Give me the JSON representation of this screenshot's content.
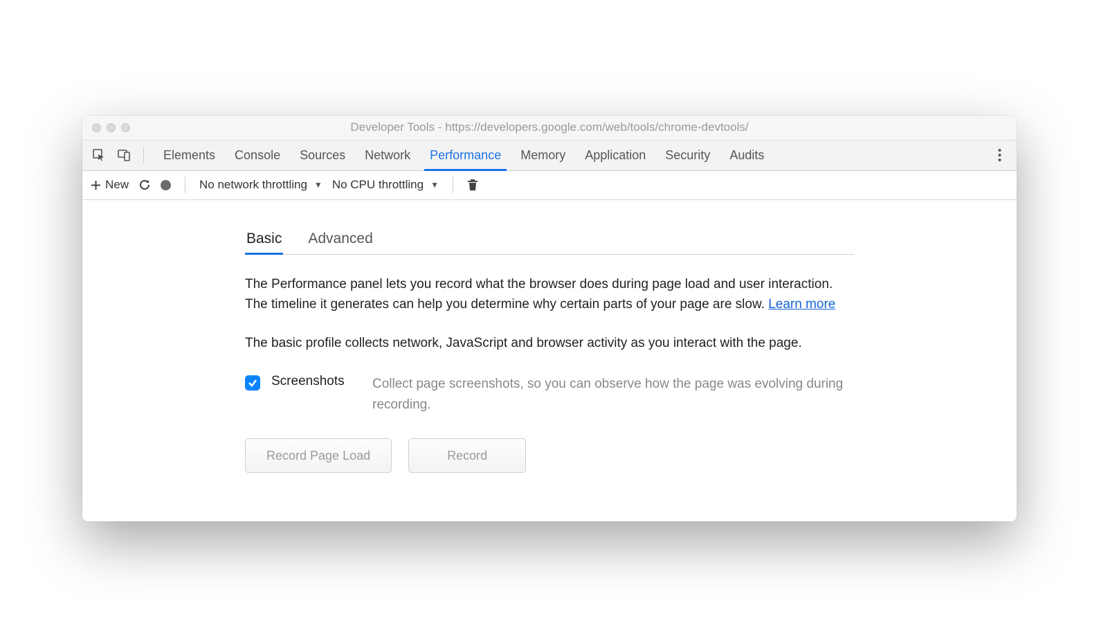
{
  "window": {
    "title": "Developer Tools - https://developers.google.com/web/tools/chrome-devtools/"
  },
  "devtoolsTabs": {
    "items": [
      "Elements",
      "Console",
      "Sources",
      "Network",
      "Performance",
      "Memory",
      "Application",
      "Security",
      "Audits"
    ],
    "activeIndex": 4
  },
  "toolbar": {
    "newLabel": "New",
    "networkThrottling": "No network throttling",
    "cpuThrottling": "No CPU throttling"
  },
  "subtabs": {
    "items": [
      "Basic",
      "Advanced"
    ],
    "activeIndex": 0
  },
  "description": {
    "text1": "The Performance panel lets you record what the browser does during page load and user interaction. The timeline it generates can help you determine why certain parts of your page are slow.  ",
    "learnMore": "Learn more",
    "text2": "The basic profile collects network, JavaScript and browser activity as you interact with the page."
  },
  "option": {
    "label": "Screenshots",
    "description": "Collect page screenshots, so you can observe how the page was evolving during recording.",
    "checked": true
  },
  "buttons": {
    "recordPageLoad": "Record Page Load",
    "record": "Record"
  }
}
